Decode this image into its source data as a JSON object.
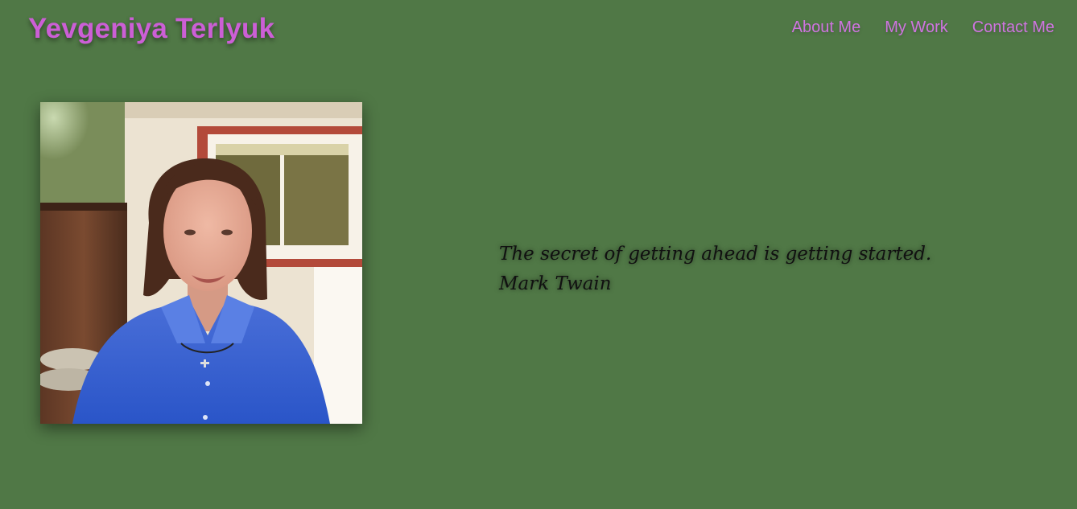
{
  "header": {
    "site_title": "Yevgeniya Terlyuk",
    "nav": [
      {
        "label": "About Me"
      },
      {
        "label": "My Work"
      },
      {
        "label": "Contact Me"
      }
    ]
  },
  "main": {
    "quote_text": "The secret of getting ahead is getting started.",
    "quote_author": "Mark Twain",
    "photo_icon": "portrait-photo"
  },
  "colors": {
    "background": "#507846",
    "title": "#cc5fd6",
    "nav_link": "#cf74e0",
    "quote_text": "#111111"
  }
}
